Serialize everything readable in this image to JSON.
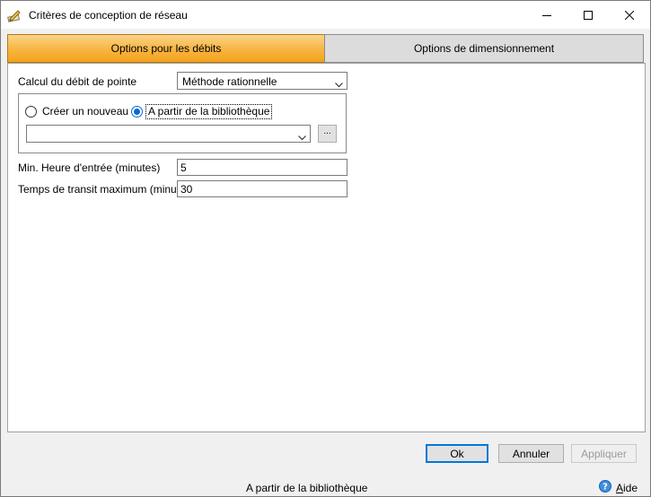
{
  "window": {
    "title": "Critères de conception de réseau",
    "icon": "pencil-icon",
    "controls": [
      "minimize-icon",
      "maximize-icon",
      "close-icon"
    ]
  },
  "tabs": [
    {
      "label": "Options pour les débits",
      "active": true
    },
    {
      "label": "Options de dimensionnement",
      "active": false
    }
  ],
  "form": {
    "peak_flow": {
      "label": "Calcul du débit de pointe",
      "value": "Méthode rationnelle"
    },
    "source": {
      "option_new": "Créer un nouveau",
      "option_library": "A partir de la bibliothèque",
      "selected": "library",
      "library_value": "",
      "browse_label": "..."
    },
    "min_inlet_time": {
      "label": "Min. Heure d'entrée (minutes)",
      "value": "5"
    },
    "max_transit_time": {
      "label": "Temps de transit maximum (minutes)",
      "value": "30"
    }
  },
  "buttons": {
    "ok": "Ok",
    "cancel": "Annuler",
    "apply": "Appliquer"
  },
  "status": {
    "text": "A partir de la bibliothèque",
    "help_icon": "help-icon",
    "help_label_underlined": "A",
    "help_label_rest": "ide"
  },
  "colors": {
    "active_tab": "#f7b540",
    "radio_selected": "#0a66d6",
    "default_button_border": "#0078d7"
  }
}
